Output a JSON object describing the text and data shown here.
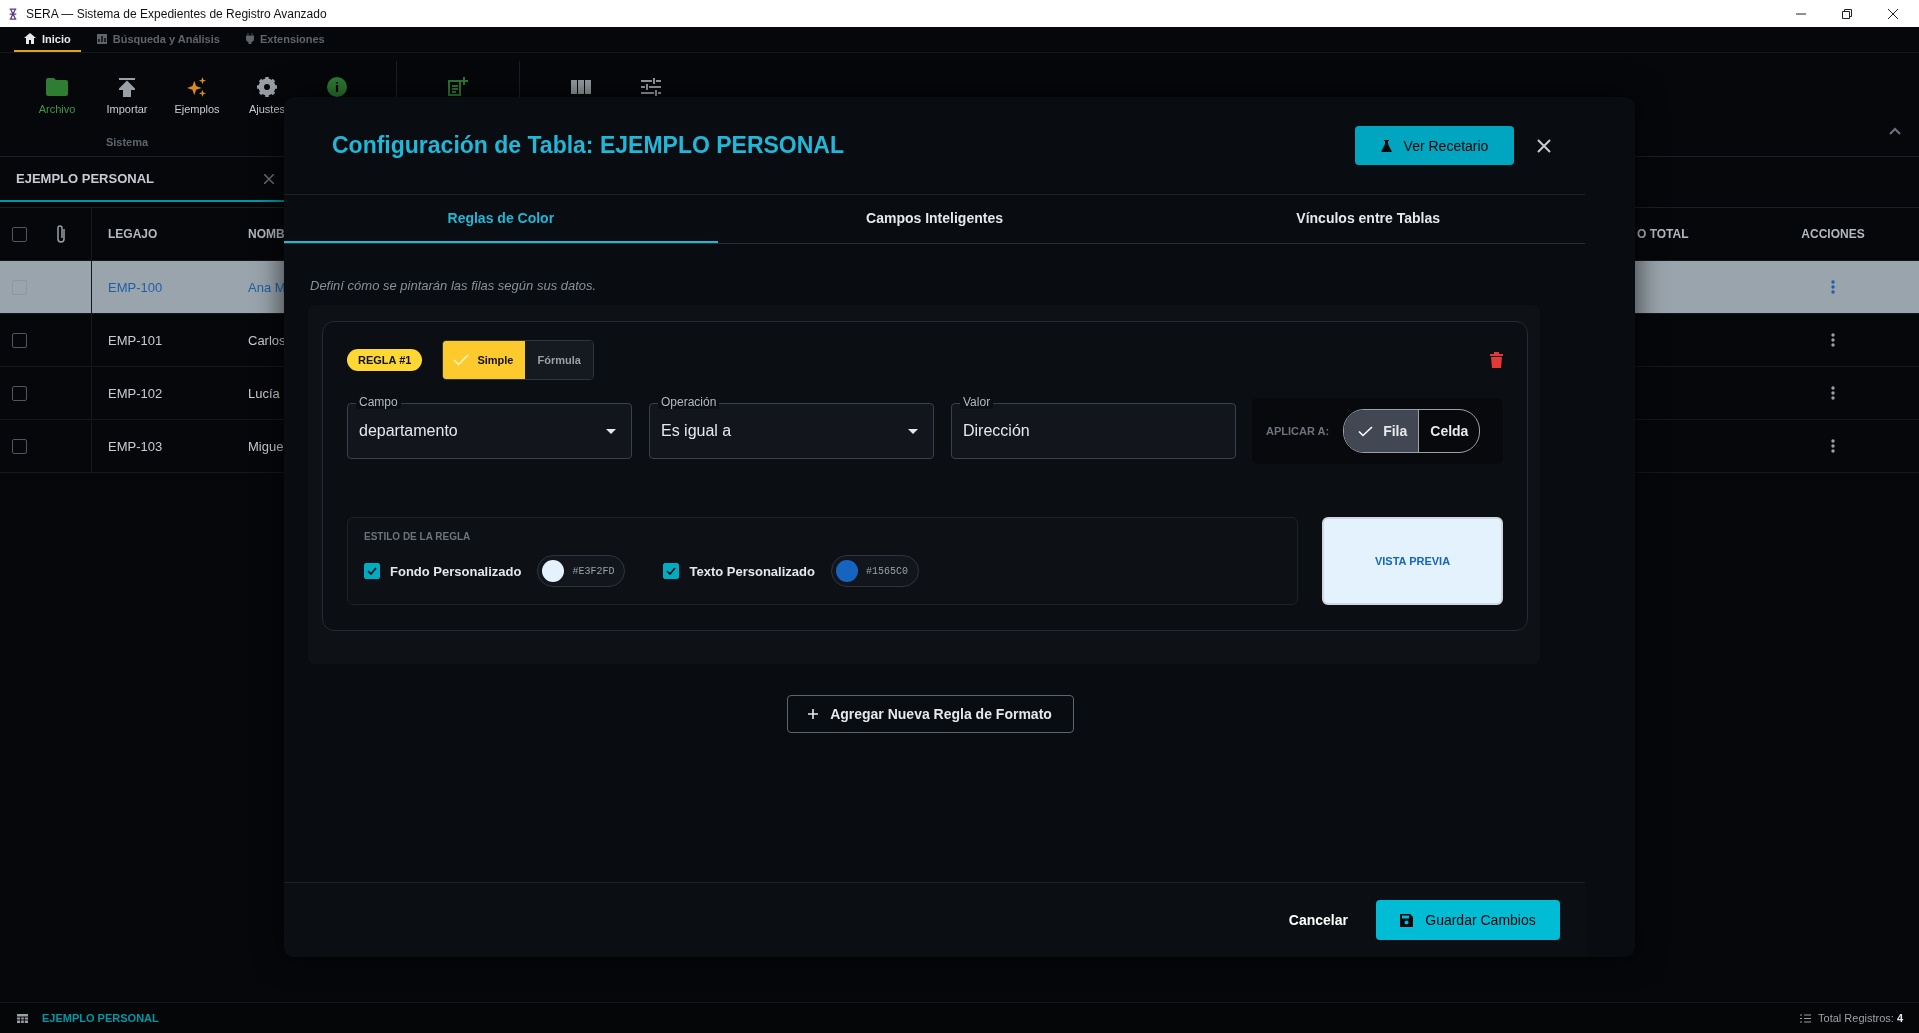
{
  "window": {
    "title": "SERA — Sistema de Expedientes de Registro Avanzado"
  },
  "ribbon_tabs": [
    {
      "label": "Inicio",
      "selected": true
    },
    {
      "label": "Búsqueda y Análisis",
      "selected": false
    },
    {
      "label": "Extensiones",
      "selected": false
    }
  ],
  "toolbar": {
    "groups": [
      {
        "label": "Sistema",
        "items": [
          "Archivo",
          "Importar",
          "Ejemplos",
          "Ajustes"
        ]
      }
    ]
  },
  "document_tab": {
    "title": "EJEMPLO PERSONAL"
  },
  "table": {
    "header_checked": false,
    "columns_left": [
      "LEGAJO",
      "NOMB"
    ],
    "columns_right": [
      "O TOTAL",
      "ACCIONES"
    ],
    "rows": [
      {
        "legajo": "EMP-100",
        "nombre": "Ana M",
        "checked": false,
        "selected": true
      },
      {
        "legajo": "EMP-101",
        "nombre": "Carlos",
        "checked": false,
        "selected": false
      },
      {
        "legajo": "EMP-102",
        "nombre": "Lucía",
        "checked": false,
        "selected": false
      },
      {
        "legajo": "EMP-103",
        "nombre": "Migue",
        "checked": false,
        "selected": false
      }
    ]
  },
  "dialog": {
    "title": "Configuración de Tabla: EJEMPLO PERSONAL",
    "recipe_button": "Ver Recetario",
    "tabs": [
      {
        "label": "Reglas de Color",
        "selected": true
      },
      {
        "label": "Campos Inteligentes",
        "selected": false
      },
      {
        "label": "Vínculos entre Tablas",
        "selected": false
      }
    ],
    "hint": "Definí cómo se pintarán las filas según sus datos.",
    "rules": [
      {
        "badge": "REGLA #1",
        "modes": [
          {
            "label": "Simple",
            "selected": true
          },
          {
            "label": "Fórmula",
            "selected": false
          }
        ],
        "fields": [
          {
            "label": "Campo",
            "value": "departamento",
            "kind": "select"
          },
          {
            "label": "Operación",
            "value": "Es igual a",
            "kind": "select"
          },
          {
            "label": "Valor",
            "value": "Dirección",
            "kind": "text"
          }
        ],
        "apply_label": "APLICAR A:",
        "apply_options": [
          {
            "label": "Fila",
            "selected": true
          },
          {
            "label": "Celda",
            "selected": false
          }
        ],
        "style_title": "ESTILO DE LA REGLA",
        "styles": [
          {
            "label": "Fondo Personalizado",
            "checked": true,
            "color": "#e3f2fd",
            "code": "#E3F2FD"
          },
          {
            "label": "Texto Personalizado",
            "checked": true,
            "color": "#1565c0",
            "code": "#1565C0"
          }
        ],
        "preview": "VISTA PREVIA"
      }
    ],
    "add_button": "Agregar Nueva Regla de Formato",
    "cancel_button": "Cancelar",
    "save_button": "Guardar Cambios"
  },
  "status_bar": {
    "table_name": "EJEMPLO PERSONAL",
    "total_label": "Total Registros:",
    "total": "4"
  }
}
